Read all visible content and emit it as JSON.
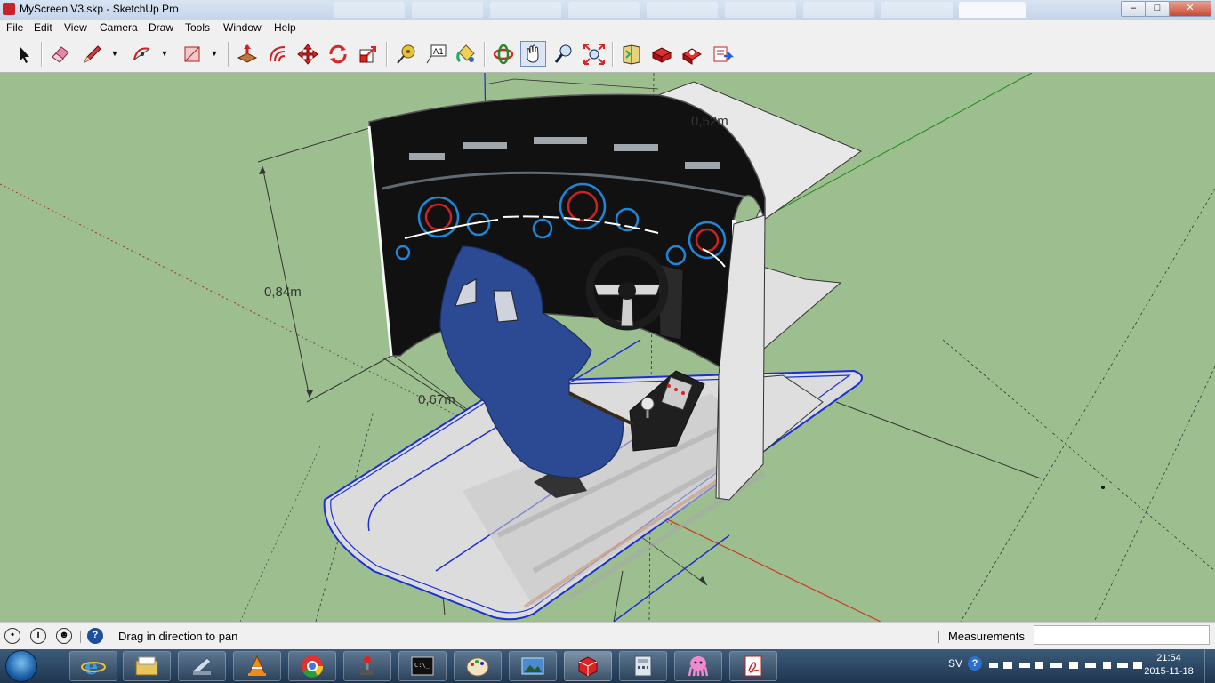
{
  "window": {
    "title": "MyScreen V3.skp - SketchUp Pro",
    "minimize": "–",
    "maximize": "□",
    "close": "✕"
  },
  "menu": {
    "items": [
      "File",
      "Edit",
      "View",
      "Camera",
      "Draw",
      "Tools",
      "Window",
      "Help"
    ]
  },
  "toolbar": {
    "tools": [
      "select-icon",
      "eraser-icon",
      "pencil-icon",
      "arc-icon",
      "rectangle-icon",
      "push-pull-icon",
      "offset-icon",
      "move-icon",
      "rotate-icon",
      "scale-icon",
      "tape-measure-icon",
      "text-icon",
      "paint-bucket-icon",
      "orbit-icon",
      "pan-icon",
      "zoom-icon",
      "zoom-extents-icon",
      "warehouse-icon",
      "components-icon",
      "share-model-icon",
      "extension-icon"
    ],
    "active_tool": "pan-icon"
  },
  "viewport": {
    "dimensions": [
      "0,84m",
      "0,67m",
      "0,52m"
    ],
    "colors": {
      "ground": "#9dbf8f",
      "selection": "#1b2fd6",
      "seat": "#2c4a94"
    }
  },
  "status": {
    "hint": "Drag in direction to pan",
    "measurements_label": "Measurements",
    "measurements_value": ""
  },
  "taskbar": {
    "apps": [
      "internet-explorer-icon",
      "file-explorer-icon",
      "scanner-icon",
      "vlc-icon",
      "chrome-icon",
      "joystick-icon",
      "command-prompt-icon",
      "paint-icon",
      "photo-viewer-icon",
      "sketchup-icon",
      "calculator-icon",
      "octopus-icon",
      "pdf-icon"
    ],
    "language": "SV",
    "time": "21:54",
    "date": "2015-11-18"
  }
}
